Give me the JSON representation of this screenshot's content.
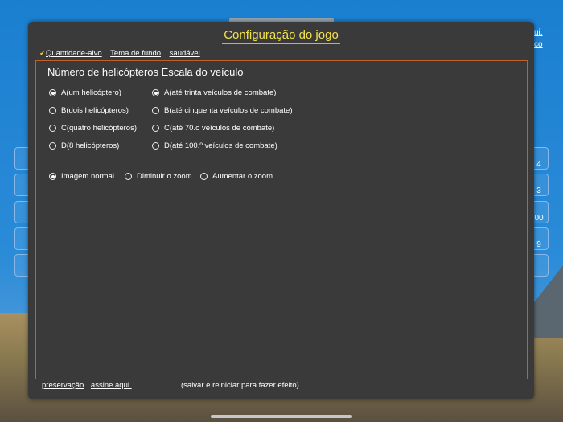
{
  "dialog": {
    "title": "Configuração do jogo",
    "tabs": [
      {
        "label": "Quantidade-alvo"
      },
      {
        "label": "Tema de fundo"
      },
      {
        "label": "saudável"
      }
    ],
    "section_title": "Número de helicópteros Escala do veículo",
    "helicopters": [
      {
        "label": "A(um helicóptero)",
        "selected": true
      },
      {
        "label": "B(dois helicópteros)",
        "selected": false
      },
      {
        "label": "C(quatro helicópteros)",
        "selected": false
      },
      {
        "label": "D(8 helicópteros)",
        "selected": false
      }
    ],
    "vehicles": [
      {
        "label": "A(até trinta veículos de combate)",
        "selected": true
      },
      {
        "label": "B(até cinquenta veículos de combate)",
        "selected": false
      },
      {
        "label": "C(até 70.o veículos de combate)",
        "selected": false
      },
      {
        "label": "D(até 100.º veículos de combate)",
        "selected": false
      }
    ],
    "zoom": [
      {
        "label": "Imagem normal",
        "selected": true
      },
      {
        "label": "Diminuir o zoom",
        "selected": false
      },
      {
        "label": "Aumentar o zoom",
        "selected": false
      }
    ],
    "footer": {
      "save_link": "preservação",
      "subscribe_link": "assine aqui.",
      "note": "(salvar e reiniciar para fazer efeito)"
    }
  },
  "background": {
    "right_tiles": [
      "4",
      "3",
      "00",
      "9",
      ""
    ],
    "right_edge_links": [
      "ui.",
      "co"
    ]
  },
  "colors": {
    "title": "#f2e24c",
    "panel_border": "#c0602a",
    "dialog_bg": "#3a3a3a"
  }
}
